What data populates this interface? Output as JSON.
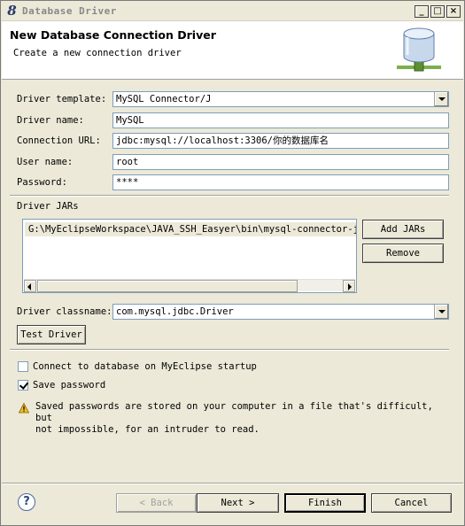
{
  "window": {
    "title": "Database Driver",
    "minimize": "_",
    "maximize": "□",
    "close": "×"
  },
  "header": {
    "title": "New Database Connection Driver",
    "subtitle": "Create a new connection driver"
  },
  "form": {
    "driver_template": {
      "label": "Driver template:",
      "value": "MySQL Connector/J"
    },
    "driver_name": {
      "label": "Driver name:",
      "value": "MySQL"
    },
    "connection_url": {
      "label": "Connection URL:",
      "value": "jdbc:mysql://localhost:3306/你的数据库名"
    },
    "user_name": {
      "label": "User name:",
      "value": "root"
    },
    "password": {
      "label": "Password:",
      "value": "****"
    }
  },
  "driver_jars": {
    "label": "Driver JARs",
    "items": [
      "G:\\MyEclipseWorkspace\\JAVA_SSH_Easyer\\bin\\mysql-connector-java"
    ],
    "add_button": "Add JARs",
    "remove_button": "Remove"
  },
  "classname": {
    "label": "Driver classname:",
    "value": "com.mysql.jdbc.Driver"
  },
  "test_button": "Test Driver",
  "options": {
    "connect_on_startup": {
      "label": "Connect to database on MyEclipse startup",
      "checked": false
    },
    "save_password": {
      "label": "Save password",
      "checked": true
    }
  },
  "warning": {
    "line1": "Saved passwords are stored on your computer in a file that's difficult, but",
    "line2": "not impossible, for an intruder to read."
  },
  "footer": {
    "help": "?",
    "back": "< Back",
    "next": "Next >",
    "finish": "Finish",
    "cancel": "Cancel"
  },
  "colors": {
    "window_bg": "#ece9d8",
    "header_bg": "#ffffff",
    "field_border": "#7f9db9",
    "disabled_text": "#a0a0a0"
  }
}
